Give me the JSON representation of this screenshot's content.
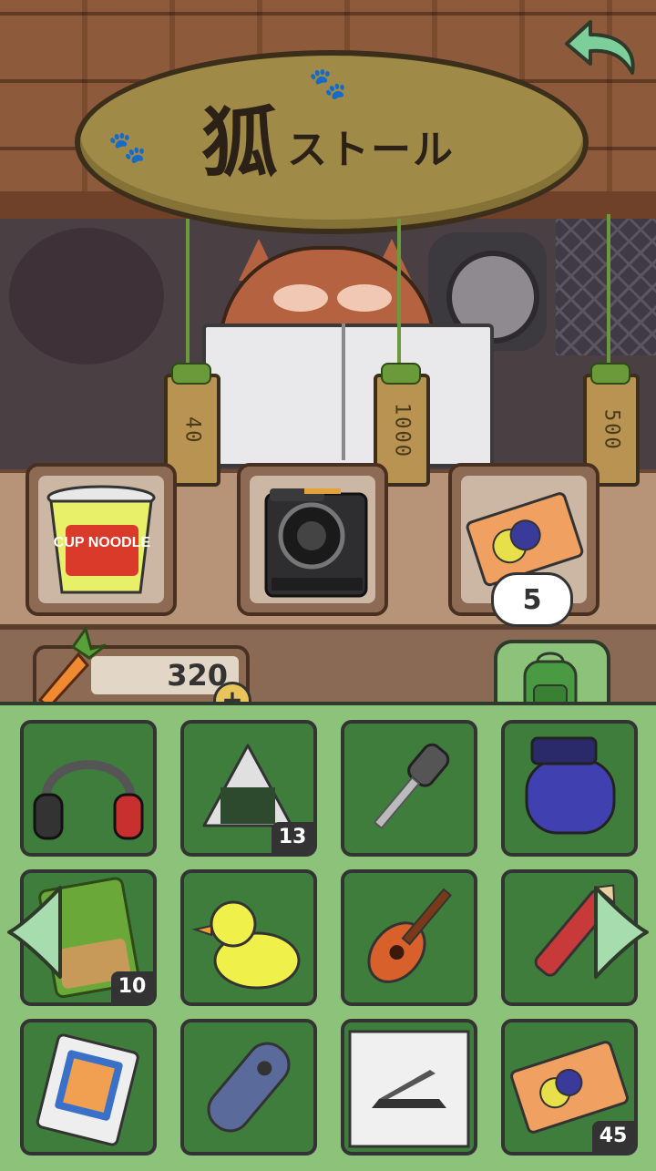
{
  "colors": {
    "inventory_bg": "#8cc27a",
    "cell_bg": "#3f7d3d",
    "sign_wood": "#a08a48",
    "back_arrow": "#7ccf9a"
  },
  "sign": {
    "kanji": "狐",
    "kana": "ストール"
  },
  "shop": {
    "items": [
      {
        "name": "cup noodle",
        "price_tag": "40",
        "icon": "cup-noodle-icon",
        "label": "CUP NOODLE"
      },
      {
        "name": "instant camera",
        "price_tag": "1000",
        "icon": "camera-icon"
      },
      {
        "name": "collection ticket",
        "price_tag": "500",
        "icon": "ticket-icon",
        "count": "5"
      }
    ]
  },
  "currency": {
    "carrots": "320",
    "plus": "+"
  },
  "inventory": {
    "items": [
      {
        "icon": "headphones-icon",
        "count": ""
      },
      {
        "icon": "onigiri-icon",
        "count": "13"
      },
      {
        "icon": "key-icon",
        "count": ""
      },
      {
        "icon": "boxing-glove-icon",
        "count": ""
      },
      {
        "icon": "snack-bag-icon",
        "count": "10"
      },
      {
        "icon": "rubber-duck-icon",
        "count": ""
      },
      {
        "icon": "ukulele-icon",
        "count": ""
      },
      {
        "icon": "firework-rocket-icon",
        "count": ""
      },
      {
        "icon": "phone-box-icon",
        "count": ""
      },
      {
        "icon": "remote-control-icon",
        "count": ""
      },
      {
        "icon": "laptop-box-icon",
        "count": ""
      },
      {
        "icon": "ticket-icon",
        "count": "45"
      }
    ]
  }
}
